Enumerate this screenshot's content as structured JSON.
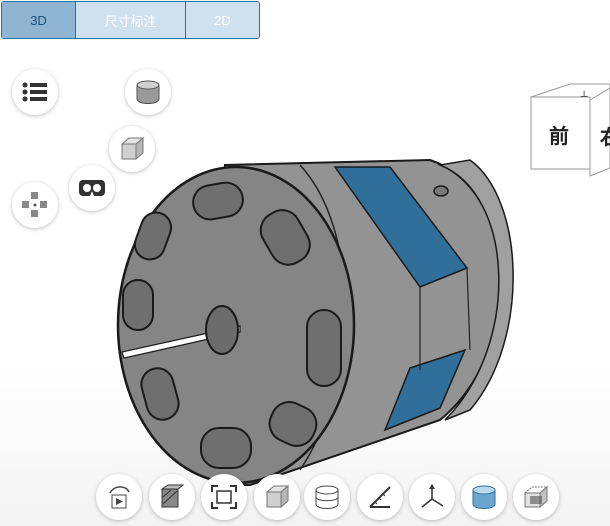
{
  "tabs": [
    {
      "label": "3D",
      "active": true
    },
    {
      "label": "尺寸标注",
      "active": false
    },
    {
      "label": "2D",
      "active": false
    }
  ],
  "view_cube": {
    "front": "前",
    "right_partial": "右"
  },
  "left_tools": [
    "list-icon",
    "cylinder-view-icon",
    "box-view-icon",
    "vr-icon",
    "explode-icon"
  ],
  "bottom_tools": [
    "rotate-play-icon",
    "section-icon",
    "fit-view-icon",
    "box-icon",
    "wireframe-icon",
    "measure-icon",
    "axes-icon",
    "shaded-icon",
    "transparent-icon"
  ],
  "colors": {
    "tab_active": "#8fb5d3",
    "tab_inactive": "#cfe0ee",
    "tab_border": "#2f6f9a",
    "part_gray": "#8e8e8e",
    "part_blue": "#2f6f9a"
  }
}
